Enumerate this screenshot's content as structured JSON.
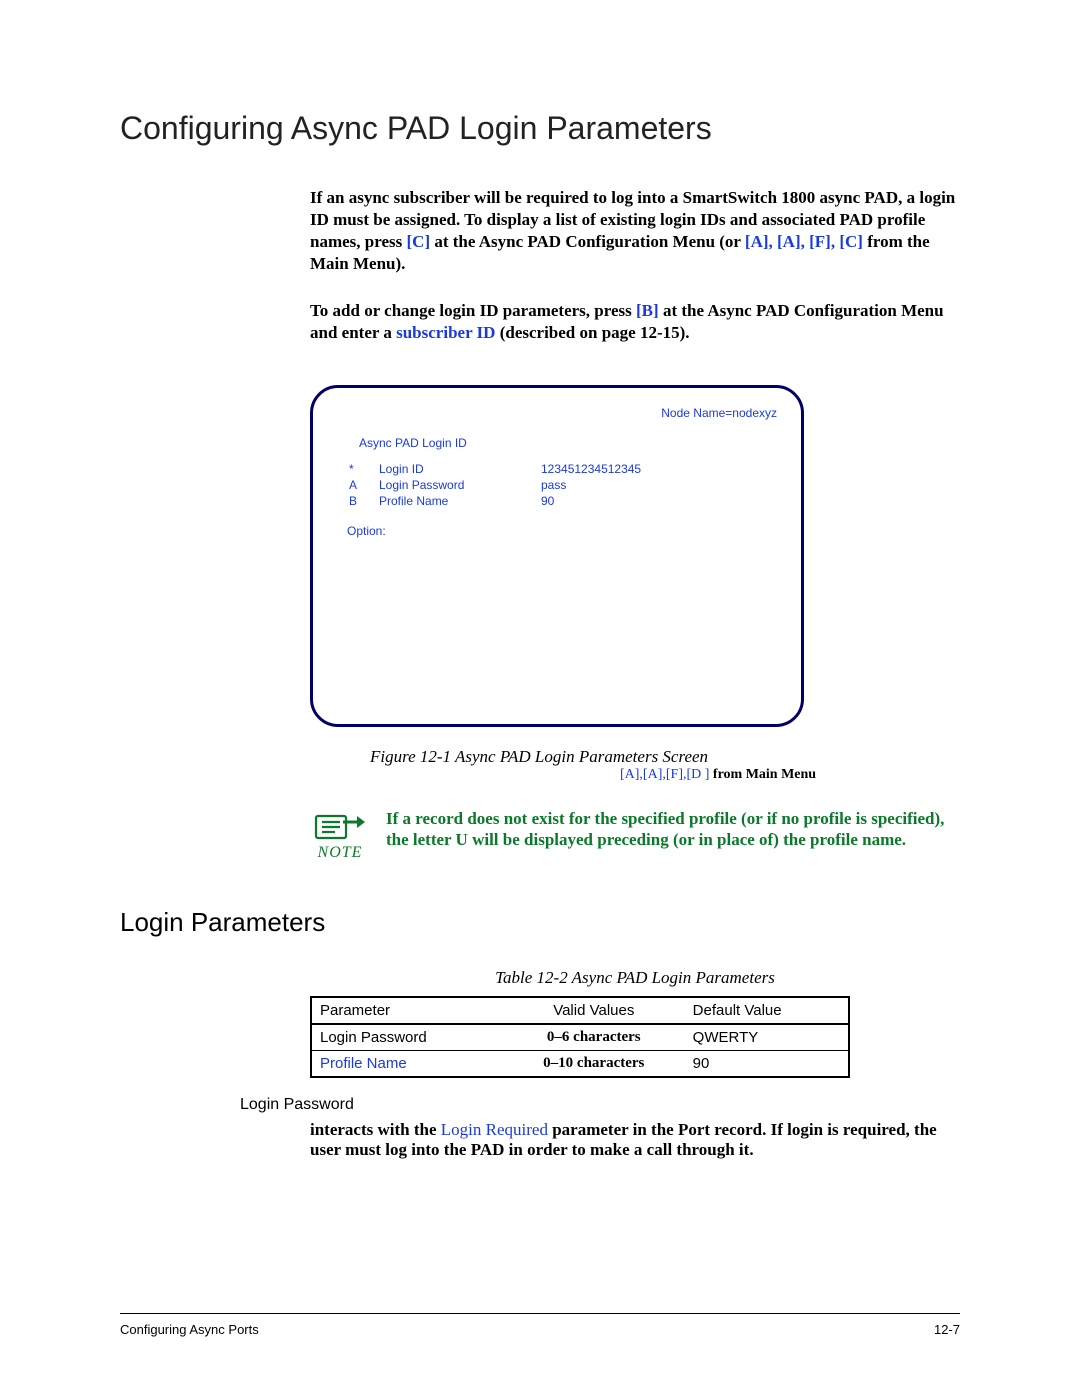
{
  "title": "Configuring Async PAD Login Parameters",
  "intro": {
    "p1a": "If an async subscriber will be required to log into a SmartSwitch 1800 async PAD, a login ID must be assigned. To display a list of existing login IDs and associated PAD profile names, press ",
    "p1key": "[C]",
    "p1b": " at the Async PAD Configuration Menu (or ",
    "p1path": "[A], [A], [F], [C]",
    "p1c": " from the Main Menu).",
    "p2a": "To add or change login ID parameters, press ",
    "p2key": "[B]",
    "p2b": " at the Async PAD Configuration Menu and enter a ",
    "p2sub": "subscriber ID",
    "p2c": " (described on page 12-15)."
  },
  "terminal": {
    "node": "Node Name=nodexyz",
    "heading": "Async PAD Login ID",
    "rows": [
      {
        "key": "*",
        "label": "Login ID",
        "value": "123451234512345"
      },
      {
        "key": "A",
        "label": "Login Password",
        "value": "pass"
      },
      {
        "key": "B",
        "label": "Profile Name",
        "value": "90"
      }
    ],
    "option": "Option:"
  },
  "figure": {
    "caption": "Figure 12-1   Async PAD Login Parameters Screen",
    "path_pre": "[A],[A],[F],[D  ]",
    "path_post": " from Main Menu"
  },
  "note": {
    "label": "NOTE",
    "text_a": "If a record does not exist for the specified profile (or if no profile is specified), the letter ",
    "text_u": "U",
    "text_b": " will be displayed preceding (or in place of) the profile name."
  },
  "subheading": "Login Parameters",
  "table": {
    "caption": "Table 12-2   Async PAD Login Parameters",
    "headers": [
      "Parameter",
      "Valid Values",
      "Default Value"
    ],
    "rows": [
      {
        "param": "Login Password",
        "param_link": false,
        "valid": "0–6 characters",
        "default": "QWERTY"
      },
      {
        "param": "Profile Name",
        "param_link": true,
        "valid": "0–10 characters",
        "default": "90"
      }
    ]
  },
  "paramdesc": {
    "name": "Login Password",
    "desc_a": "interacts with the ",
    "desc_link": "Login Required",
    "desc_b": " parameter in the Port record. If login is required, the user must log into the PAD in order to make a call through it."
  },
  "footer": {
    "left": "Configuring Async Ports",
    "right": "12-7"
  }
}
